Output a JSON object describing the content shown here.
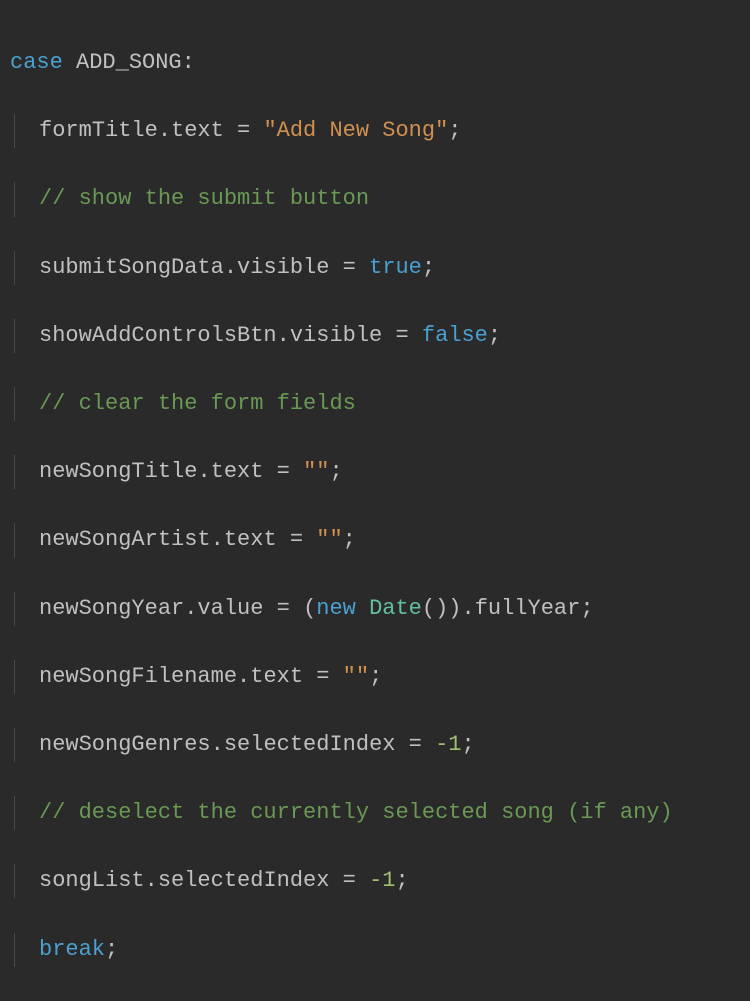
{
  "code": {
    "line1_case": "case",
    "line1_const": "ADD_SONG",
    "line1_colon": ":",
    "line2_obj": "formTitle",
    "line2_prop": ".text",
    "line2_eq": " = ",
    "line2_str": "\"Add New Song\"",
    "line2_semi": ";",
    "line3_comment": "// show the submit button",
    "line4_obj": "submitSongData",
    "line4_prop": ".visible",
    "line4_eq": " = ",
    "line4_bool": "true",
    "line4_semi": ";",
    "line5_obj": "showAddControlsBtn",
    "line5_prop": ".visible",
    "line5_eq": " = ",
    "line5_bool": "false",
    "line5_semi": ";",
    "line6_comment": "// clear the form fields",
    "line7_obj": "newSongTitle",
    "line7_prop": ".text",
    "line7_eq": " = ",
    "line7_str": "\"\"",
    "line7_semi": ";",
    "line8_obj": "newSongArtist",
    "line8_prop": ".text",
    "line8_eq": " = ",
    "line8_str": "\"\"",
    "line8_semi": ";",
    "line9_obj": "newSongYear",
    "line9_prop": ".value",
    "line9_eq": " = ",
    "line9_paren1": "(",
    "line9_new": "new",
    "line9_sp": " ",
    "line9_class": "Date",
    "line9_call": "())",
    "line9_prop2": ".fullYear",
    "line9_semi": ";",
    "line10_obj": "newSongFilename",
    "line10_prop": ".text",
    "line10_eq": " = ",
    "line10_str": "\"\"",
    "line10_semi": ";",
    "line11_obj": "newSongGenres",
    "line11_prop": ".selectedIndex",
    "line11_eq": " = ",
    "line11_num": "-1",
    "line11_semi": ";",
    "line12_comment": "// deselect the currently selected song (if any)",
    "line13_obj": "songList",
    "line13_prop": ".selectedIndex",
    "line13_eq": " = ",
    "line13_num": "-1",
    "line13_semi": ";",
    "line14_break": "break",
    "line14_semi": ";"
  }
}
